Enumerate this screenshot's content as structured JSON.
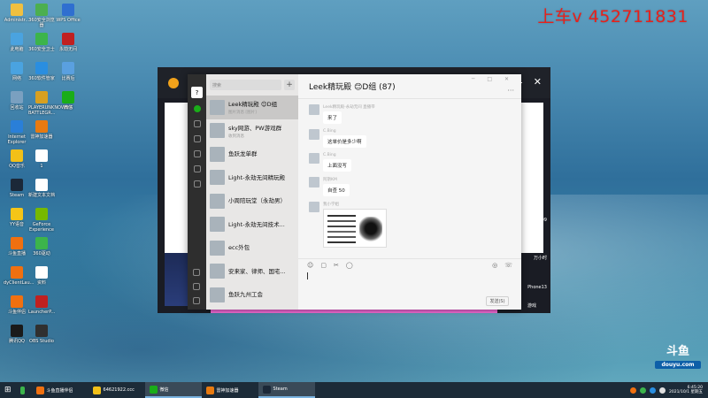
{
  "overlay": {
    "text": "上车v 452711831"
  },
  "desktop_icons": [
    {
      "label": "Administr...",
      "color": "#f0c040"
    },
    {
      "label": "360安全浏览器",
      "color": "#4caf50"
    },
    {
      "label": "WPS Office",
      "color": "#2f6fd0"
    },
    {
      "label": "此电脑",
      "color": "#4aa3e0"
    },
    {
      "label": "360安全卫士",
      "color": "#3cb44b"
    },
    {
      "label": "永劫无间",
      "color": "#c02020"
    },
    {
      "label": "网络",
      "color": "#4aa3e0"
    },
    {
      "label": "360软件管家",
      "color": "#2a8ee0"
    },
    {
      "label": "比赛后",
      "color": "#5aa0e0"
    },
    {
      "label": "回收站",
      "color": "#7aa0c0"
    },
    {
      "label": "PLAYERUNKNOWN'S BATTLEGR...",
      "color": "#d8a020"
    },
    {
      "label": "微信",
      "color": "#1aad19"
    },
    {
      "label": "Internet Explorer",
      "color": "#2a7fd8"
    },
    {
      "label": "雷神加速器",
      "color": "#e87a10"
    },
    {
      "label": "QQ音乐",
      "color": "#f2c018"
    },
    {
      "label": "1",
      "color": "#ffffff"
    },
    {
      "label": "Steam",
      "color": "#1b2838"
    },
    {
      "label": "新建文本文档",
      "color": "#ffffff"
    },
    {
      "label": "YY语音",
      "color": "#f5c518"
    },
    {
      "label": "GeForce Experience",
      "color": "#76b900"
    },
    {
      "label": "斗鱼直播",
      "color": "#f07010"
    },
    {
      "label": "360驱动",
      "color": "#3cb44b"
    },
    {
      "label": "dyClientLau...",
      "color": "#f07010"
    },
    {
      "label": "资料",
      "color": "#ffffff"
    },
    {
      "label": "斗鱼伴侣",
      "color": "#f07010"
    },
    {
      "label": "LauncherP...",
      "color": "#c02020"
    },
    {
      "label": "腾讯QQ",
      "color": "#1a1a1a"
    },
    {
      "label": "OBS Studio",
      "color": "#303030"
    }
  ],
  "chat": {
    "search_placeholder": "搜索",
    "plus": "+",
    "title": "Leek精玩殿 😊D组 (87)",
    "window_buttons": "─ □ ✕",
    "more": "···",
    "conversations": [
      {
        "name": "Leek精玩殿 😊D组",
        "preview": "图片消息 [图片]",
        "time": "",
        "selected": true
      },
      {
        "name": "sky网游、PW游戏群",
        "preview": "收到消息",
        "time": "",
        "selected": false
      },
      {
        "name": "鱼跃龙单群",
        "preview": "",
        "time": "",
        "selected": false
      },
      {
        "name": "Light-永劫无间精玩殿",
        "preview": "",
        "time": "",
        "selected": false
      },
      {
        "name": "小周陪玩堂（永劫男）",
        "preview": "",
        "time": "",
        "selected": false
      },
      {
        "name": "Light-永劫无间技术...",
        "preview": "",
        "time": "",
        "selected": false
      },
      {
        "name": "ecc外包",
        "preview": "",
        "time": "",
        "selected": false
      },
      {
        "name": "安来家、律师、国宅...",
        "preview": "",
        "time": "",
        "selected": false
      },
      {
        "name": "鱼跃九州工会",
        "preview": "",
        "time": "",
        "selected": false
      }
    ],
    "messages": [
      {
        "who": "Leek精玩殿-永劫无间 直播带",
        "text": "来了"
      },
      {
        "who": "C.Bing",
        "text": "这单价是多少啊"
      },
      {
        "who": "C.Bing",
        "text": "上面没写"
      },
      {
        "who": "阿斯KM",
        "text": "自查 50"
      },
      {
        "who": "我小学姐",
        "text": "",
        "image": true
      }
    ],
    "toolbar_left": [
      "☺",
      "▢",
      "✂",
      "◯"
    ],
    "toolbar_right": [
      "◎",
      "☏"
    ],
    "send": "发送(S)"
  },
  "side_labels": {
    "a": "9999",
    "b": "万小时",
    "c": "Phone13",
    "d": "游戏"
  },
  "taskbar": {
    "items": [
      {
        "label": "",
        "color": "#3cb44b",
        "active": false
      },
      {
        "label": "斗鱼直播伴侣",
        "color": "#f07010",
        "active": false
      },
      {
        "label": "64621922.ccc",
        "color": "#f2c018",
        "active": false
      },
      {
        "label": "微信",
        "color": "#1aad19",
        "active": true
      },
      {
        "label": "雷神加速器",
        "color": "#e87a10",
        "active": false
      },
      {
        "label": "Steam",
        "color": "#1b2838",
        "active": true
      }
    ],
    "time": "6:45:20",
    "date": "2021/10/1 星期五"
  },
  "douyu": {
    "logo": "斗鱼",
    "sub": "douyu.com"
  }
}
